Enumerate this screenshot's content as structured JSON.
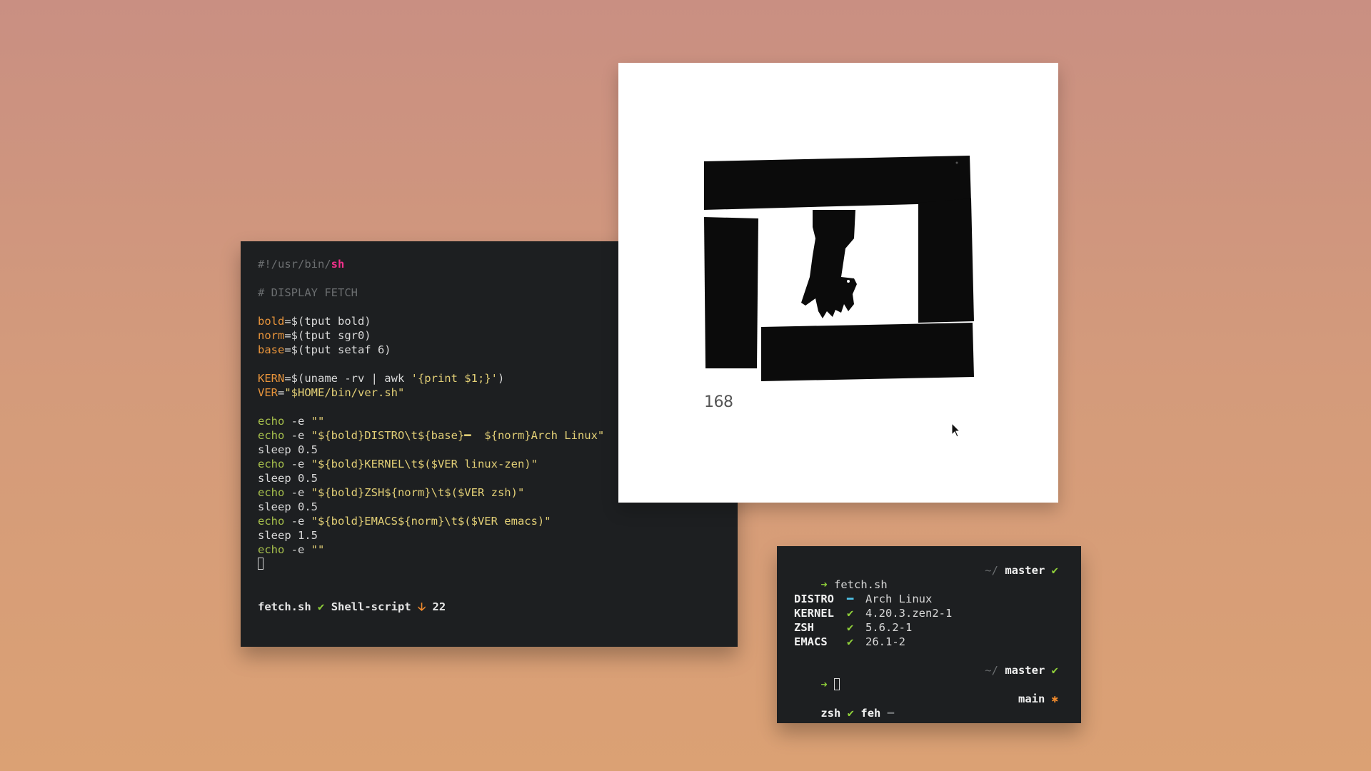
{
  "editor": {
    "shebang": {
      "prefix": "#!/usr/bin/",
      "shell": "sh"
    },
    "comment": "# DISPLAY FETCH",
    "vars": [
      {
        "name": "bold",
        "rest": "=$(tput bold)"
      },
      {
        "name": "norm",
        "rest": "=$(tput sgr0)"
      },
      {
        "name": "base",
        "rest": "=$(tput setaf 6)"
      }
    ],
    "kern": {
      "name": "KERN",
      "eq": "=$(uname -rv | awk ",
      "str": "'{print $1;}'",
      "end": ")"
    },
    "ver": {
      "name": "VER",
      "eq": "=",
      "str": "\"$HOME/bin/ver.sh\""
    },
    "echo_cmd": "echo",
    "echo_flag": " -e ",
    "sleep_cmd": "sleep",
    "lines": {
      "echo1": "\"\"",
      "echo2": "\"${bold}DISTRO\\t${base}━  ${norm}Arch Linux\"",
      "sleep1": " 0.5",
      "echo3": "\"${bold}KERNEL\\t$($VER linux-zen)\"",
      "sleep2": " 0.5",
      "echo4": "\"${bold}ZSH${norm}\\t$($VER zsh)\"",
      "sleep3": " 0.5",
      "echo5": "\"${bold}EMACS${norm}\\t$($VER emacs)\"",
      "sleep4": " 1.5",
      "echo6": "\"\""
    },
    "modeline": {
      "file": "fetch.sh",
      "check": "✔",
      "mode": "Shell-script",
      "arrow": "🡣",
      "line": "22"
    }
  },
  "image": {
    "caption": "168"
  },
  "terminal": {
    "prompt_arrow": "➜",
    "command": "fetch.sh",
    "dir": "~/",
    "branch": "master",
    "branch_check": "✔",
    "rows": [
      {
        "key": "DISTRO",
        "mark": "━",
        "value": "Arch Linux"
      },
      {
        "key": "KERNEL",
        "mark": "✔",
        "value": "4.20.3.zen2-1"
      },
      {
        "key": "ZSH",
        "mark": "✔",
        "value": "5.6.2-1"
      },
      {
        "key": "EMACS",
        "mark": "✔",
        "value": "26.1-2"
      }
    ],
    "status": {
      "shell": "zsh",
      "shell_check": "✔",
      "app": "feh",
      "app_mark": "━",
      "right": "main",
      "right_mark": "✱"
    }
  },
  "colors": {
    "accent_green": "#8fcf3a",
    "accent_pink": "#f0308a",
    "accent_orange": "#e8943b",
    "bg_window": "#1d1f21"
  }
}
